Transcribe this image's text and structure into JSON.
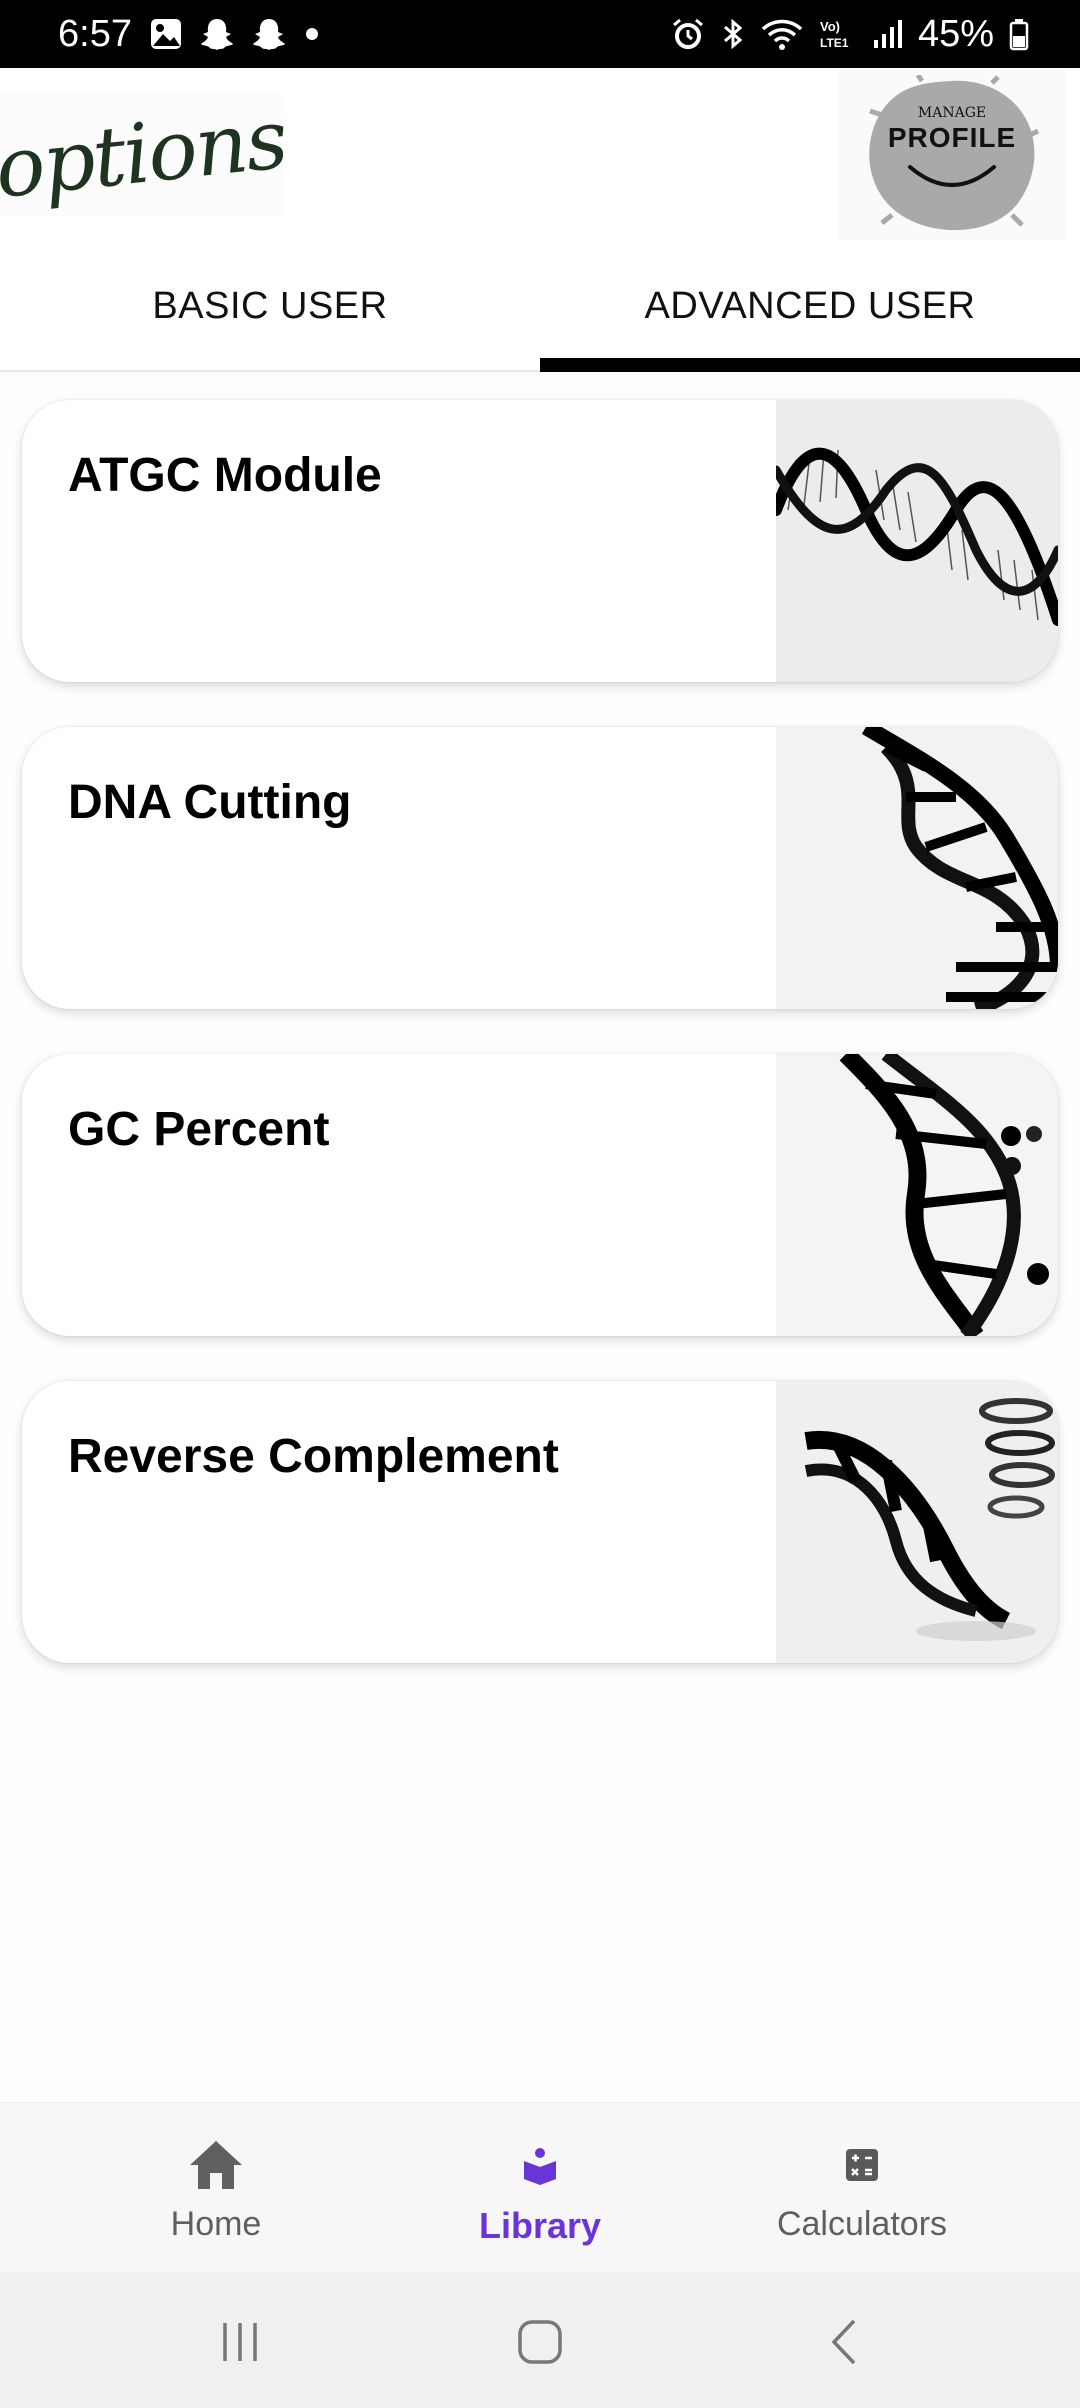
{
  "status_bar": {
    "time": "6:57",
    "battery_text": "45%"
  },
  "header": {
    "logo_text": "options",
    "profile_small": "MANAGE",
    "profile_big": "PROFILE"
  },
  "tabs": [
    {
      "label": "BASIC USER",
      "selected": false
    },
    {
      "label": "ADVANCED USER",
      "selected": true
    }
  ],
  "cards": [
    {
      "title": "ATGC Module",
      "icon": "dna-helix-image"
    },
    {
      "title": "DNA Cutting",
      "icon": "dna-strand-image"
    },
    {
      "title": "GC Percent",
      "icon": "dna-molecule-image"
    },
    {
      "title": "Reverse Complement",
      "icon": "dna-ribbon-image"
    }
  ],
  "bottom_nav": [
    {
      "label": "Home",
      "icon": "home-icon",
      "active": false
    },
    {
      "label": "Library",
      "icon": "library-icon",
      "active": true
    },
    {
      "label": "Calculators",
      "icon": "calculator-icon",
      "active": false
    }
  ],
  "colors": {
    "accent": "#6a35d8",
    "tab_indicator": "#000000",
    "logo": "#1e3320"
  }
}
